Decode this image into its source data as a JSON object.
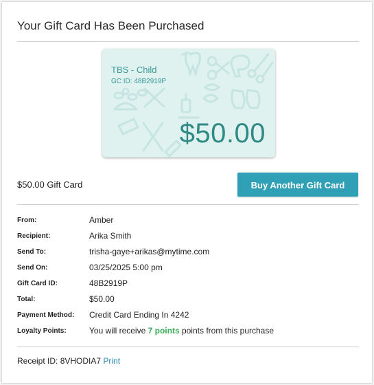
{
  "page": {
    "title": "Your Gift Card Has Been Purchased"
  },
  "card": {
    "name": "TBS - Child",
    "gc_id_label": "GC ID: 48B2919P",
    "amount": "$50.00",
    "background_color": "#dff2f0",
    "accent_color": "#2f8985"
  },
  "summary": {
    "label": "$50.00 Gift Card",
    "buy_button": "Buy Another Gift Card",
    "button_color": "#2fa0b5"
  },
  "details": {
    "from_label": "From:",
    "from_value": "Amber",
    "recipient_label": "Recipient:",
    "recipient_value": "Arika Smith",
    "send_to_label": "Send To:",
    "send_to_value": "trisha-gaye+arikas@mytime.com",
    "send_on_label": "Send On:",
    "send_on_value": "03/25/2025 5:00 pm",
    "gift_card_id_label": "Gift Card ID:",
    "gift_card_id_value": "48B2919P",
    "total_label": "Total:",
    "total_value": "$50.00",
    "payment_method_label": "Payment Method:",
    "payment_method_value": "Credit Card Ending In 4242",
    "loyalty_label": "Loyalty Points:",
    "loyalty_prefix": "You will receive ",
    "loyalty_points": "7 points",
    "loyalty_suffix": " points from this purchase"
  },
  "footer": {
    "receipt_label": "Receipt ID: 8VHODIA7",
    "print_link": "Print"
  }
}
